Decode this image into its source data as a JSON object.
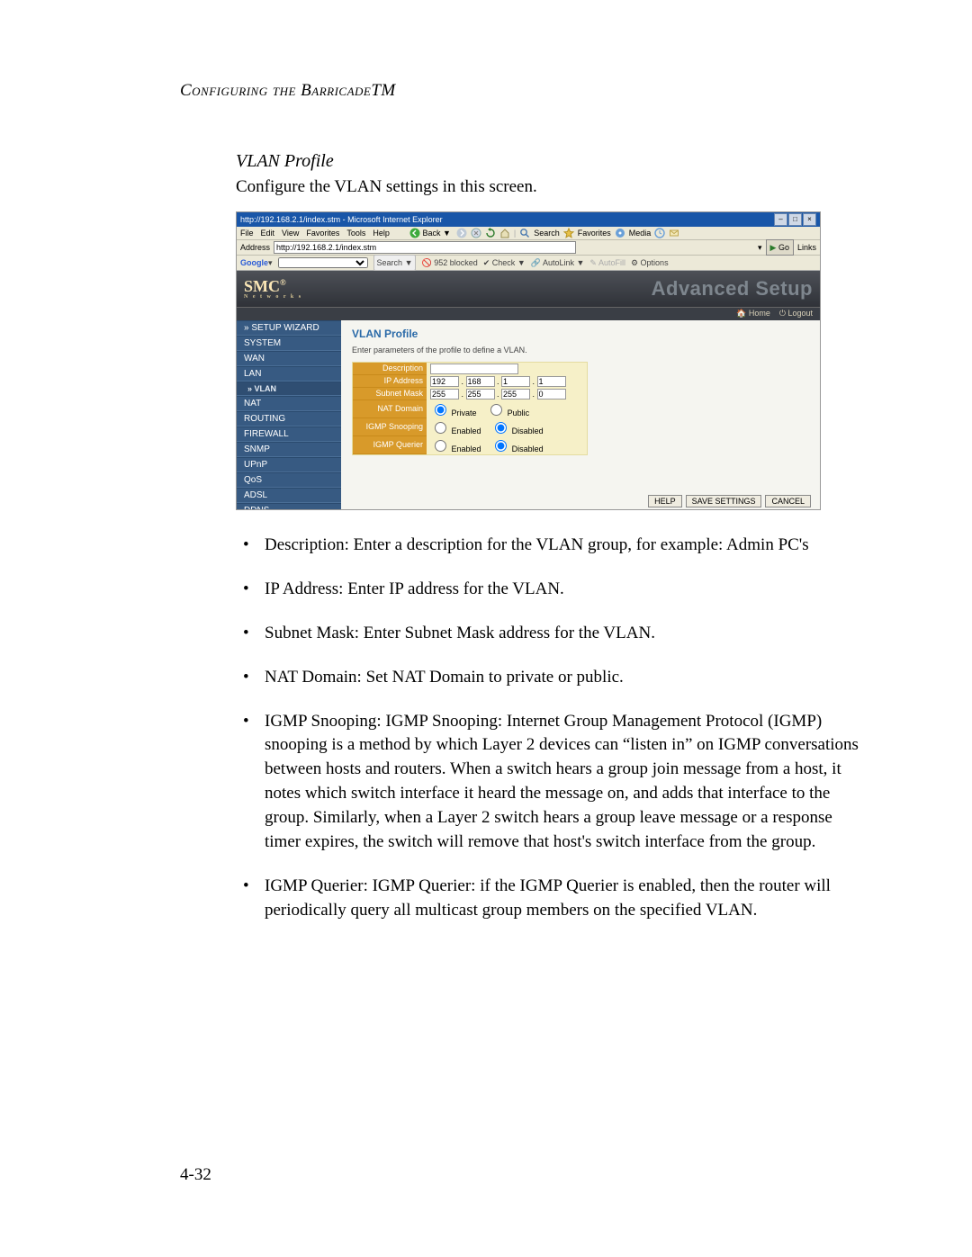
{
  "running_head": "Configuring the BarricadeTM",
  "section": {
    "title": "VLAN Profile",
    "intro": "Configure the VLAN settings in this screen."
  },
  "ie": {
    "title": "http://192.168.2.1/index.stm - Microsoft Internet Explorer",
    "menus": [
      "File",
      "Edit",
      "View",
      "Favorites",
      "Tools",
      "Help"
    ],
    "toolbar": {
      "back": "Back",
      "search": "Search",
      "favorites": "Favorites",
      "media": "Media"
    },
    "address_label": "Address",
    "address_value": "http://192.168.2.1/index.stm",
    "go": "Go",
    "links": "Links"
  },
  "gt": {
    "brand": "Google",
    "search": "Search",
    "blocked": "952 blocked",
    "check": "Check",
    "autolink": "AutoLink",
    "autofill": "AutoFill",
    "options": "Options"
  },
  "smc": {
    "logo": "SMC",
    "logo_sub": "N e t w o r k s",
    "heading": "Advanced Setup",
    "home": "Home",
    "logout": "Logout"
  },
  "nav": {
    "items": [
      {
        "label": "» SETUP WIZARD"
      },
      {
        "label": "SYSTEM"
      },
      {
        "label": "WAN"
      },
      {
        "label": "LAN"
      },
      {
        "label": "» VLAN",
        "sub": true,
        "active": true
      },
      {
        "label": "NAT"
      },
      {
        "label": "ROUTING"
      },
      {
        "label": "FIREWALL"
      },
      {
        "label": "SNMP"
      },
      {
        "label": "UPnP"
      },
      {
        "label": "QoS"
      },
      {
        "label": "ADSL"
      },
      {
        "label": "DDNS"
      }
    ]
  },
  "form": {
    "title": "VLAN Profile",
    "hint": "Enter parameters of the profile to define a VLAN.",
    "rows": {
      "description": {
        "label": "Description",
        "value": ""
      },
      "ip": {
        "label": "IP Address",
        "a": "192",
        "b": "168",
        "c": "1",
        "d": "1"
      },
      "mask": {
        "label": "Subnet Mask",
        "a": "255",
        "b": "255",
        "c": "255",
        "d": "0"
      },
      "natd": {
        "label": "NAT Domain",
        "opt1": "Private",
        "opt2": "Public",
        "sel": "Private"
      },
      "snoop": {
        "label": "IGMP Snooping",
        "opt1": "Enabled",
        "opt2": "Disabled",
        "sel": "Disabled"
      },
      "querier": {
        "label": "IGMP Querier",
        "opt1": "Enabled",
        "opt2": "Disabled",
        "sel": "Disabled"
      }
    },
    "buttons": {
      "help": "HELP",
      "save": "SAVE SETTINGS",
      "cancel": "CANCEL"
    }
  },
  "bullets": [
    "Description: Enter a description for the VLAN group, for example: Admin PC's",
    "IP Address: Enter IP address for the VLAN.",
    "Subnet Mask: Enter Subnet Mask address for the VLAN.",
    "NAT Domain: Set NAT Domain to private or public.",
    "IGMP Snooping: IGMP Snooping: Internet Group Management Protocol (IGMP) snooping is a method by which Layer 2 devices can “listen in” on IGMP conversations between hosts and routers. When a switch hears a group join message from a host, it notes which switch interface it heard the message on, and adds that interface to the group. Similarly, when a Layer 2 switch hears a group leave message or a response timer expires, the switch will remove that host's switch interface from the group.",
    "IGMP Querier: IGMP Querier: if the IGMP Querier is enabled, then the router will periodically query all multicast group members on the specified VLAN."
  ],
  "page_number": "4-32"
}
